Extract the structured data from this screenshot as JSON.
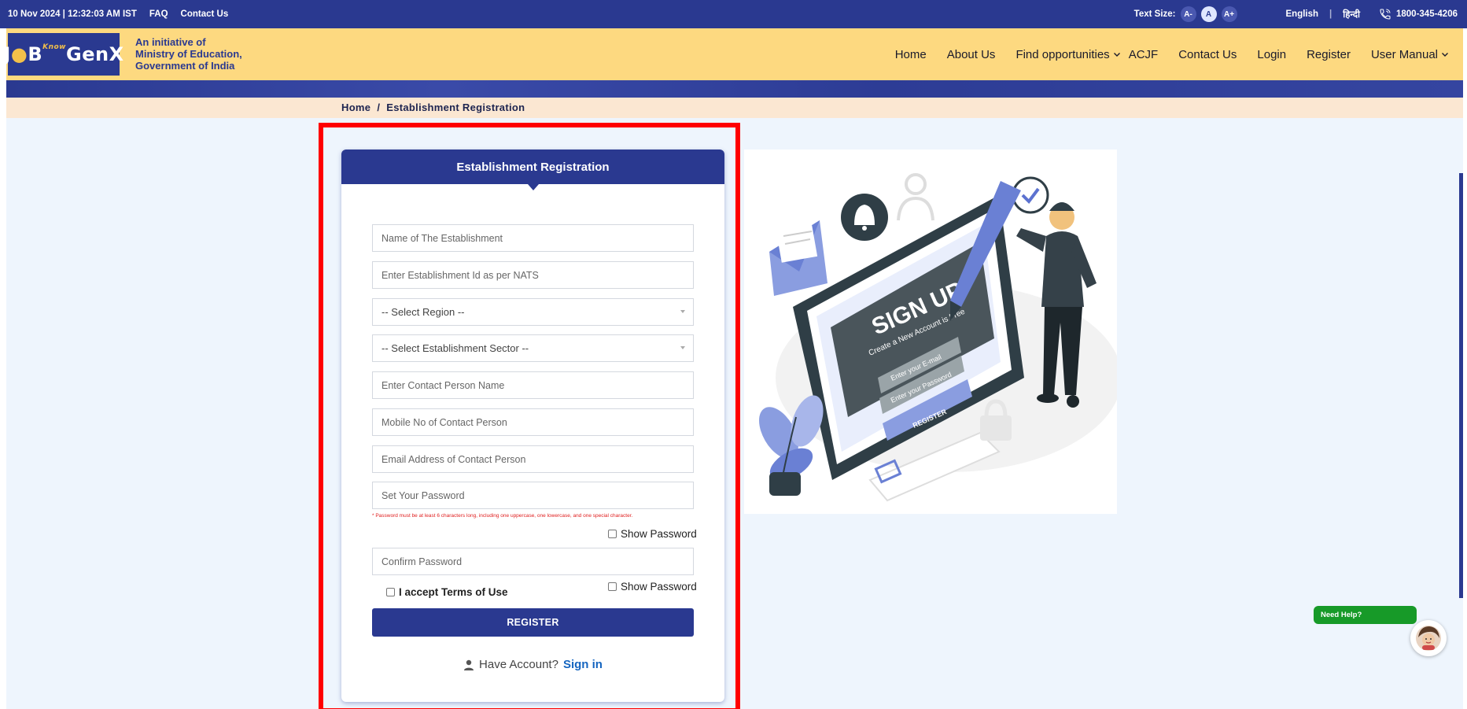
{
  "topbar": {
    "datetime": "10 Nov 2024 | 12:32:03 AM IST",
    "faq": "FAQ",
    "contact": "Contact Us",
    "text_size_label": "Text Size:",
    "text_size_options": [
      "A-",
      "A",
      "A+"
    ],
    "language_en": "English",
    "language_hi": "हिन्दी",
    "phone": "1800-345-4206"
  },
  "header": {
    "logo_text_1": "J",
    "logo_text_2": "B",
    "logo_text_3": "GenX",
    "logo_small": "Know",
    "initiative_line1": "An initiative of",
    "initiative_line2": "Ministry of Education,",
    "initiative_line3": "Government of India",
    "nav": {
      "home": "Home",
      "about": "About Us",
      "find": "Find opportunities",
      "acjf": "ACJF",
      "contact": "Contact Us",
      "login": "Login",
      "register": "Register",
      "manual": "User Manual"
    }
  },
  "breadcrumb": {
    "home": "Home",
    "sep": "/",
    "current": "Establishment Registration"
  },
  "form": {
    "title": "Establishment Registration",
    "name_placeholder": "Name of The Establishment",
    "nats_placeholder": "Enter Establishment Id as per NATS",
    "region_select": "-- Select Region --",
    "sector_select": "-- Select Establishment Sector --",
    "contact_name_placeholder": "Enter Contact Person Name",
    "mobile_placeholder": "Mobile No of Contact Person",
    "email_placeholder": "Email Address of Contact Person",
    "password_placeholder": "Set Your Password",
    "password_hint": "* Password must be at least 6 characters long, including one uppercase, one lowercase, and one special character.",
    "show_password": "Show Password",
    "confirm_placeholder": "Confirm Password",
    "terms": "I accept Terms of Use",
    "register_button": "REGISTER",
    "have_account": "Have Account?",
    "sign_in": "Sign in"
  },
  "illustration": {
    "title": "SIGN UP",
    "subtitle": "Create a New Account is Free",
    "email": "Enter your E-mail",
    "password": "Enter your Password",
    "button": "REGISTER"
  },
  "help": {
    "label": "Need Help?"
  },
  "colors": {
    "brand_navy": "#2a3990",
    "header_yellow": "#fdd980",
    "breadcrumb_bg": "#fbe7d2",
    "page_bg": "#eef5fd",
    "highlight_red": "#ff0000",
    "help_green": "#179a28",
    "link_blue": "#1565c0"
  }
}
